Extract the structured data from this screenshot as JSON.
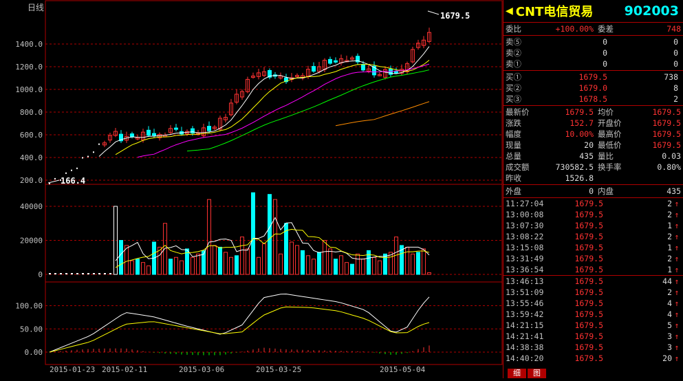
{
  "chart": {
    "period_label": "日线",
    "high_marker": "1679.5",
    "low_marker": "166.4",
    "price_ticks": [
      "1400.0",
      "1200.0",
      "1000.0",
      "800.0",
      "600.0",
      "400.0",
      "200.0"
    ],
    "volume_ticks": [
      "40000",
      "20000",
      "0"
    ],
    "macd_ticks": [
      "100.00",
      "50.00",
      "0.00"
    ],
    "dates": [
      "2015-01-23",
      "2015-02-11",
      "2015-03-06",
      "2015-03-25",
      "2015-05-04"
    ],
    "colors": {
      "up": "#ff3232",
      "down": "#00ffff",
      "grid": "#b00000",
      "ma5": "#ffffff",
      "ma10": "#ffff00",
      "ma20": "#ff00ff",
      "ma30": "#00ff00",
      "ma60": "#ff8c00"
    }
  },
  "quote": {
    "name": "CNT电信贸易",
    "code": "902003",
    "order_rows": [
      {
        "l1": "委比",
        "v1": "+100.00%",
        "l2": "委差",
        "v2": "748"
      }
    ],
    "asks": [
      {
        "label": "卖⑤",
        "price": "0",
        "vol": "0"
      },
      {
        "label": "卖②",
        "price": "0",
        "vol": "0"
      },
      {
        "label": "卖①",
        "price": "0",
        "vol": "0"
      }
    ],
    "bids": [
      {
        "label": "买①",
        "price": "1679.5",
        "vol": "738"
      },
      {
        "label": "买②",
        "price": "1679.0",
        "vol": "8"
      },
      {
        "label": "买③",
        "price": "1678.5",
        "vol": "2"
      }
    ],
    "stats": [
      {
        "l1": "最新价",
        "v1": "1679.5",
        "l2": "均价",
        "v2": "1679.5"
      },
      {
        "l1": "涨跌",
        "v1": "152.7",
        "l2": "开盘价",
        "v2": "1679.5"
      },
      {
        "l1": "幅度",
        "v1": "10.00%",
        "l2": "最高价",
        "v2": "1679.5"
      },
      {
        "l1": "现量",
        "v1": "20",
        "l2": "最低价",
        "v2": "1679.5"
      },
      {
        "l1": "总量",
        "v1": "435",
        "l2": "量比",
        "v2": "0.03"
      },
      {
        "l1": "成交额",
        "v1": "730582.5",
        "l2": "换手率",
        "v2": "0.80%"
      },
      {
        "l1": "昨收",
        "v1": "1526.8",
        "l2": "",
        "v2": ""
      }
    ],
    "outer_label": "外盘",
    "outer": "0",
    "inner_label": "内盘",
    "inner": "435",
    "ticks": [
      {
        "time": "11:27:04",
        "price": "1679.5",
        "vol": "2",
        "dir": "↑"
      },
      {
        "time": "13:00:08",
        "price": "1679.5",
        "vol": "2",
        "dir": "↑"
      },
      {
        "time": "13:07:30",
        "price": "1679.5",
        "vol": "1",
        "dir": "↑"
      },
      {
        "time": "13:08:22",
        "price": "1679.5",
        "vol": "2",
        "dir": "↑"
      },
      {
        "time": "13:15:08",
        "price": "1679.5",
        "vol": "1",
        "dir": "↑"
      },
      {
        "time": "13:31:49",
        "price": "1679.5",
        "vol": "2",
        "dir": "↑"
      },
      {
        "time": "13:36:54",
        "price": "1679.5",
        "vol": "1",
        "dir": "↑"
      },
      {
        "time": "13:46:13",
        "price": "1679.5",
        "vol": "44",
        "dir": "↑"
      },
      {
        "time": "13:51:09",
        "price": "1679.5",
        "vol": "2",
        "dir": "↑"
      },
      {
        "time": "13:55:46",
        "price": "1679.5",
        "vol": "4",
        "dir": "↑"
      },
      {
        "time": "13:59:42",
        "price": "1679.5",
        "vol": "4",
        "dir": "↑"
      },
      {
        "time": "14:21:15",
        "price": "1679.5",
        "vol": "5",
        "dir": "↑"
      },
      {
        "time": "14:21:41",
        "price": "1679.5",
        "vol": "3",
        "dir": "↑"
      },
      {
        "time": "14:38:38",
        "price": "1679.5",
        "vol": "3",
        "dir": "↑"
      },
      {
        "time": "14:40:20",
        "price": "1679.5",
        "vol": "20",
        "dir": "↑"
      }
    ],
    "tabs": [
      "细",
      "图"
    ]
  }
}
